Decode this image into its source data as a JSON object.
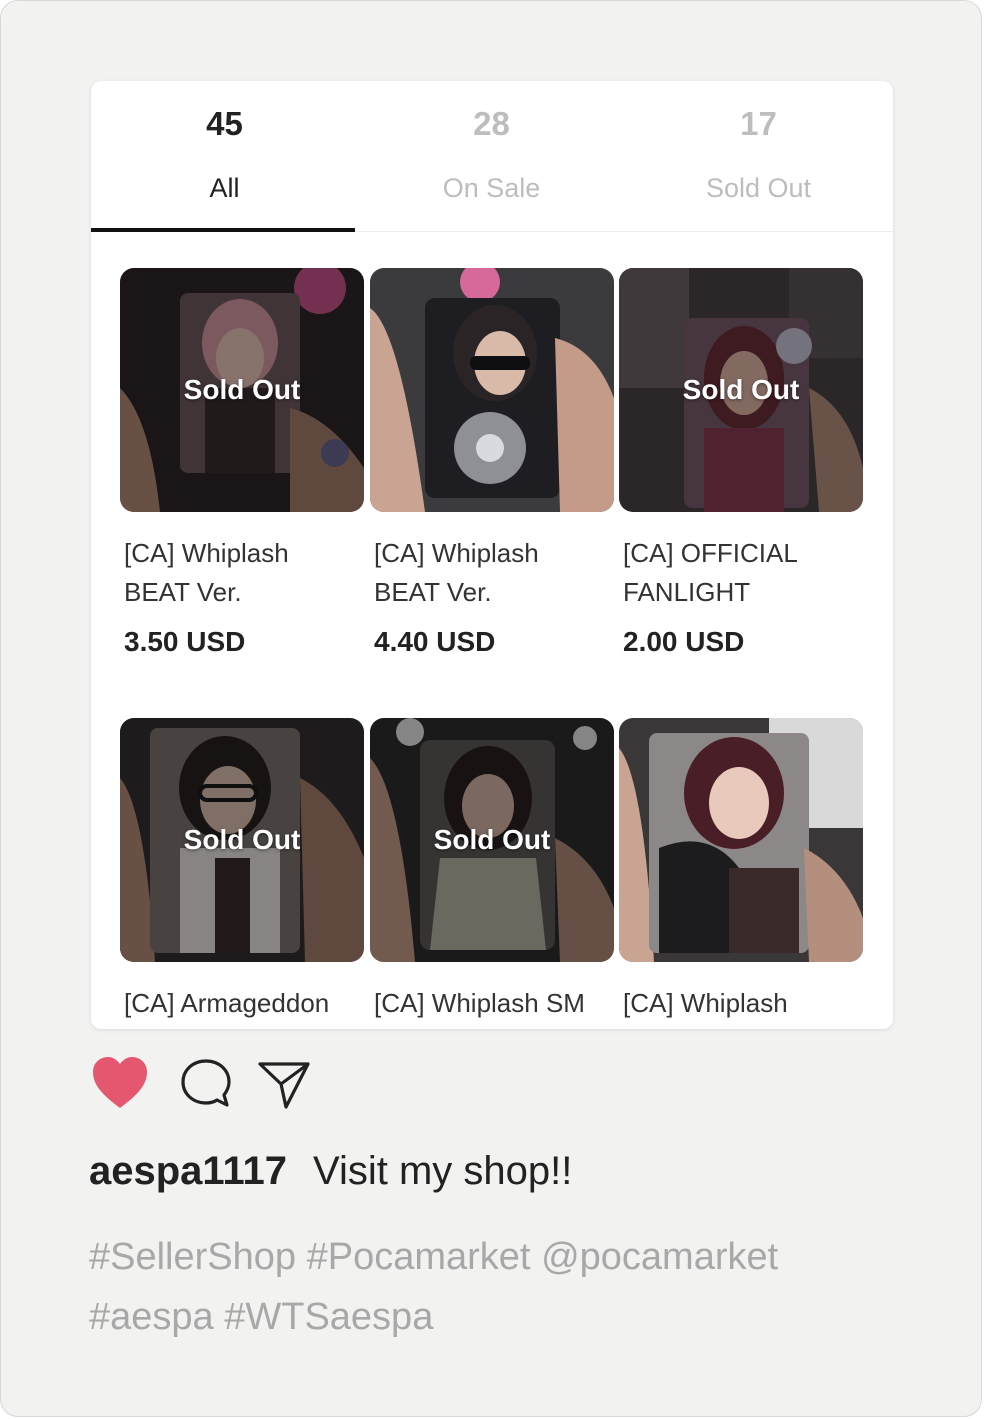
{
  "tabs": [
    {
      "count": "45",
      "label": "All",
      "active": true
    },
    {
      "count": "28",
      "label": "On Sale",
      "active": false
    },
    {
      "count": "17",
      "label": "Sold Out",
      "active": false
    }
  ],
  "sold_out_label": "Sold Out",
  "products": [
    {
      "name": "[CA] Whiplash BEAT Ver.",
      "price": "3.50 USD",
      "sold_out": true
    },
    {
      "name": "[CA] Whiplash BEAT Ver.",
      "price": "4.40 USD",
      "sold_out": false
    },
    {
      "name": "[CA] OFFICIAL FANLIGHT",
      "price": "2.00 USD",
      "sold_out": true
    },
    {
      "name": "[CA] Armageddon",
      "price": "",
      "sold_out": true
    },
    {
      "name": "[CA] Whiplash SM",
      "price": "",
      "sold_out": true
    },
    {
      "name": "[CA] Whiplash",
      "price": "",
      "sold_out": false
    }
  ],
  "post": {
    "username": "aespa1117",
    "message": "Visit my shop!!",
    "tags_line1": [
      "#SellerShop",
      "#Pocamarket",
      "@pocamarket"
    ],
    "tags_line2": [
      "#aespa",
      "#WTSaespa"
    ]
  },
  "icons": {
    "like": "heart-icon",
    "comment": "comment-bubble-icon",
    "share": "send-icon"
  },
  "colors": {
    "like": "#e5566f",
    "active_tab": "#111111",
    "inactive_tab": "#bdbdbd",
    "hashtag": "#a8a8a8"
  }
}
